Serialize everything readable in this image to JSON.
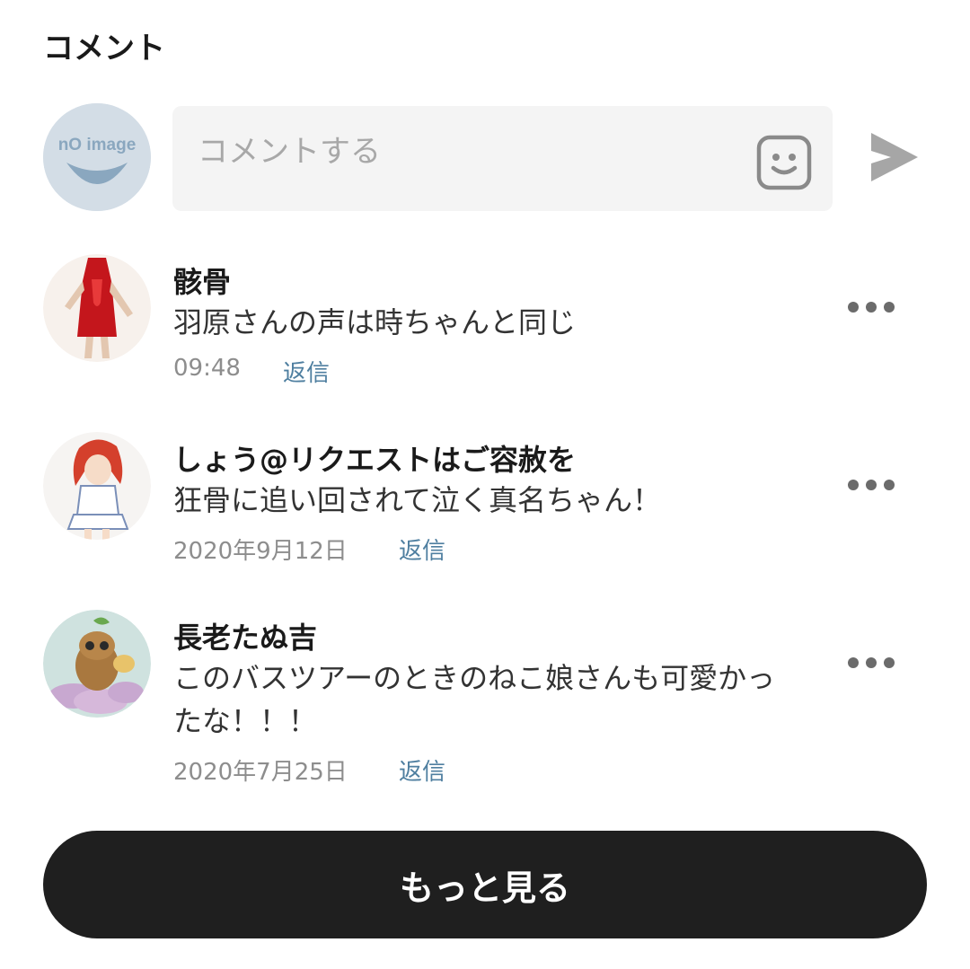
{
  "section": {
    "title": "コメント"
  },
  "composer": {
    "avatar_icon": "no-image-avatar",
    "avatar_text": "nO image",
    "placeholder": "コメントする",
    "emoji_icon": "smiley-icon",
    "send_icon": "send-icon"
  },
  "comments": [
    {
      "user": "骸骨",
      "text": "羽原さんの声は時ちゃんと同じ",
      "time": "09:48",
      "reply_label": "返信",
      "avatar_icon": "user-avatar"
    },
    {
      "user": "しょう@リクエストはご容赦を",
      "text": "狂骨に追い回されて泣く真名ちゃん！",
      "time": "2020年9月12日",
      "reply_label": "返信",
      "avatar_icon": "user-avatar"
    },
    {
      "user": "長老たぬ吉",
      "text": "このバスツアーのときのねこ娘さんも可愛かったな！！！",
      "time": "2020年7月25日",
      "reply_label": "返信",
      "avatar_icon": "user-avatar"
    }
  ],
  "load_more": {
    "label": "もっと見る"
  },
  "colors": {
    "accent_reply": "#4f7fa0",
    "button_bg": "#1f1f1f",
    "input_bg": "#f4f4f4"
  }
}
